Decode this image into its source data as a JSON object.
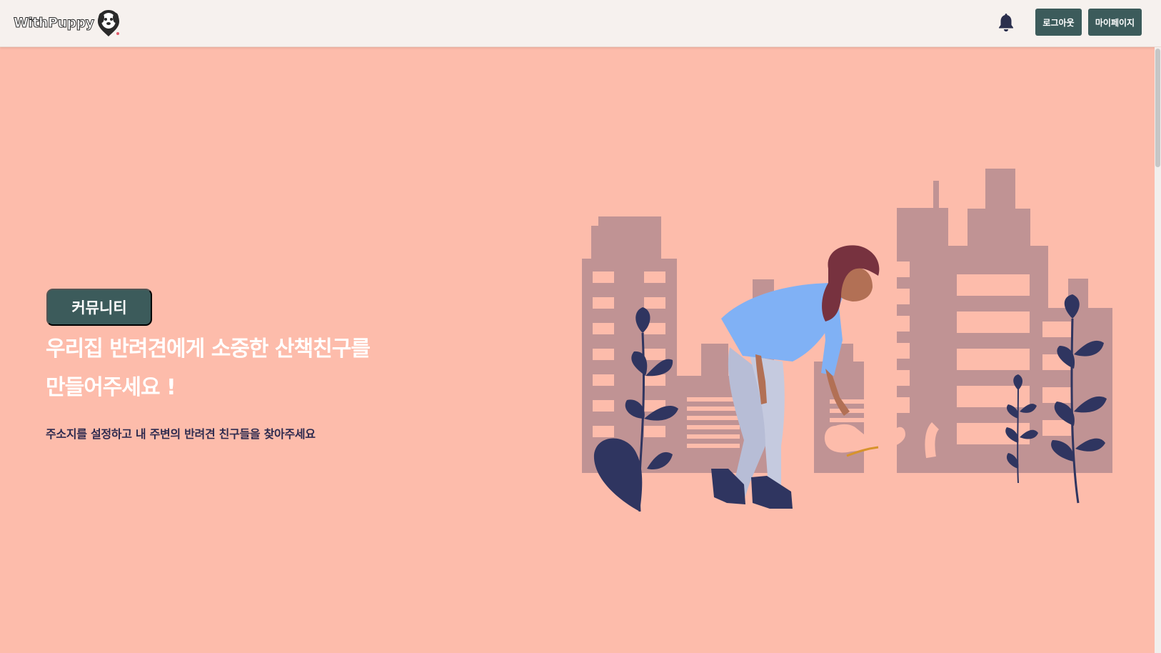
{
  "header": {
    "logo_text": "WithPuppy",
    "icons": {
      "logo": "dog-face-logo-icon",
      "notifications": "bell-icon"
    },
    "logout_label": "로그아웃",
    "mypage_label": "마이페이지"
  },
  "hero": {
    "community_label": "커뮤니티",
    "headline_line1": "우리집 반려견에게 소중한 산책친구를",
    "headline_line2": "만들어주세요 !",
    "subline": "주소지를 설정하고 내 주변의 반려견 친구들을 찾아주세요",
    "illustration": "woman-walking-dog-city-illustration"
  },
  "colors": {
    "background": "#fdbcab",
    "header_background": "#f6f1ee",
    "button_background": "#3c5b5b",
    "headline_text": "#ffffff",
    "subline_text": "#2f2b4f",
    "buildings": "#c09394",
    "leaves": "#2f3560",
    "shirt": "#80b1f5"
  }
}
